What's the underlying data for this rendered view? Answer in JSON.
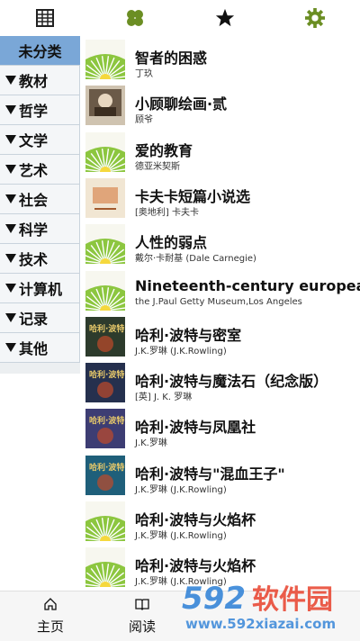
{
  "topbar": {
    "icons": [
      "abacus-icon",
      "clover-icon",
      "star-icon",
      "gear-icon"
    ],
    "accent_green": "#6b8e23"
  },
  "sidebar": {
    "categories": [
      {
        "label": "未分类",
        "selected": true
      },
      {
        "label": "教材",
        "selected": false
      },
      {
        "label": "哲学",
        "selected": false
      },
      {
        "label": "文学",
        "selected": false
      },
      {
        "label": "艺术",
        "selected": false
      },
      {
        "label": "社会",
        "selected": false
      },
      {
        "label": "科学",
        "selected": false
      },
      {
        "label": "技术",
        "selected": false
      },
      {
        "label": "计算机",
        "selected": false
      },
      {
        "label": "记录",
        "selected": false
      },
      {
        "label": "其他",
        "selected": false
      }
    ],
    "selected_color": "#7aa7d7"
  },
  "books": [
    {
      "title": "智者的困惑",
      "author": "丁玖",
      "cover": "default"
    },
    {
      "title": "小顾聊绘画·贰",
      "author": "顾爷",
      "cover": "painting"
    },
    {
      "title": "爱的教育",
      "author": "德亚米契斯",
      "cover": "default"
    },
    {
      "title": "卡夫卡短篇小说选",
      "author": "[奥地利] 卡夫卡",
      "cover": "kafka"
    },
    {
      "title": "人性的弱点",
      "author": "戴尔·卡耐基 (Dale Carnegie)",
      "cover": "default"
    },
    {
      "title": "Nineteenth-century european p",
      "author": "the J.Paul Getty Museum,Los Angeles",
      "cover": "default"
    },
    {
      "title": "哈利·波特与密室",
      "author": "J.K.罗琳 (J.K.Rowling)",
      "cover": "hp2"
    },
    {
      "title": "哈利·波特与魔法石（纪念版）",
      "author": "[英] J. K. 罗琳",
      "cover": "hp1"
    },
    {
      "title": "哈利·波特与凤凰社",
      "author": "J.K.罗琳",
      "cover": "hp5"
    },
    {
      "title": "哈利·波特与\"混血王子\"",
      "author": "J.K.罗琳 (J.K.Rowling)",
      "cover": "hp6"
    },
    {
      "title": "哈利·波特与火焰杯",
      "author": "J.K.罗琳 (J.K.Rowling)",
      "cover": "default"
    },
    {
      "title": "哈利·波特与火焰杯",
      "author": "J.K.罗琳 (J.K.Rowling)",
      "cover": "default"
    }
  ],
  "bottom_tabs": [
    {
      "label": "主页",
      "icon": "home-icon"
    },
    {
      "label": "阅读",
      "icon": "book-icon"
    }
  ],
  "watermark": {
    "brand": "592软件园",
    "url": "www.592xiazai.com"
  }
}
